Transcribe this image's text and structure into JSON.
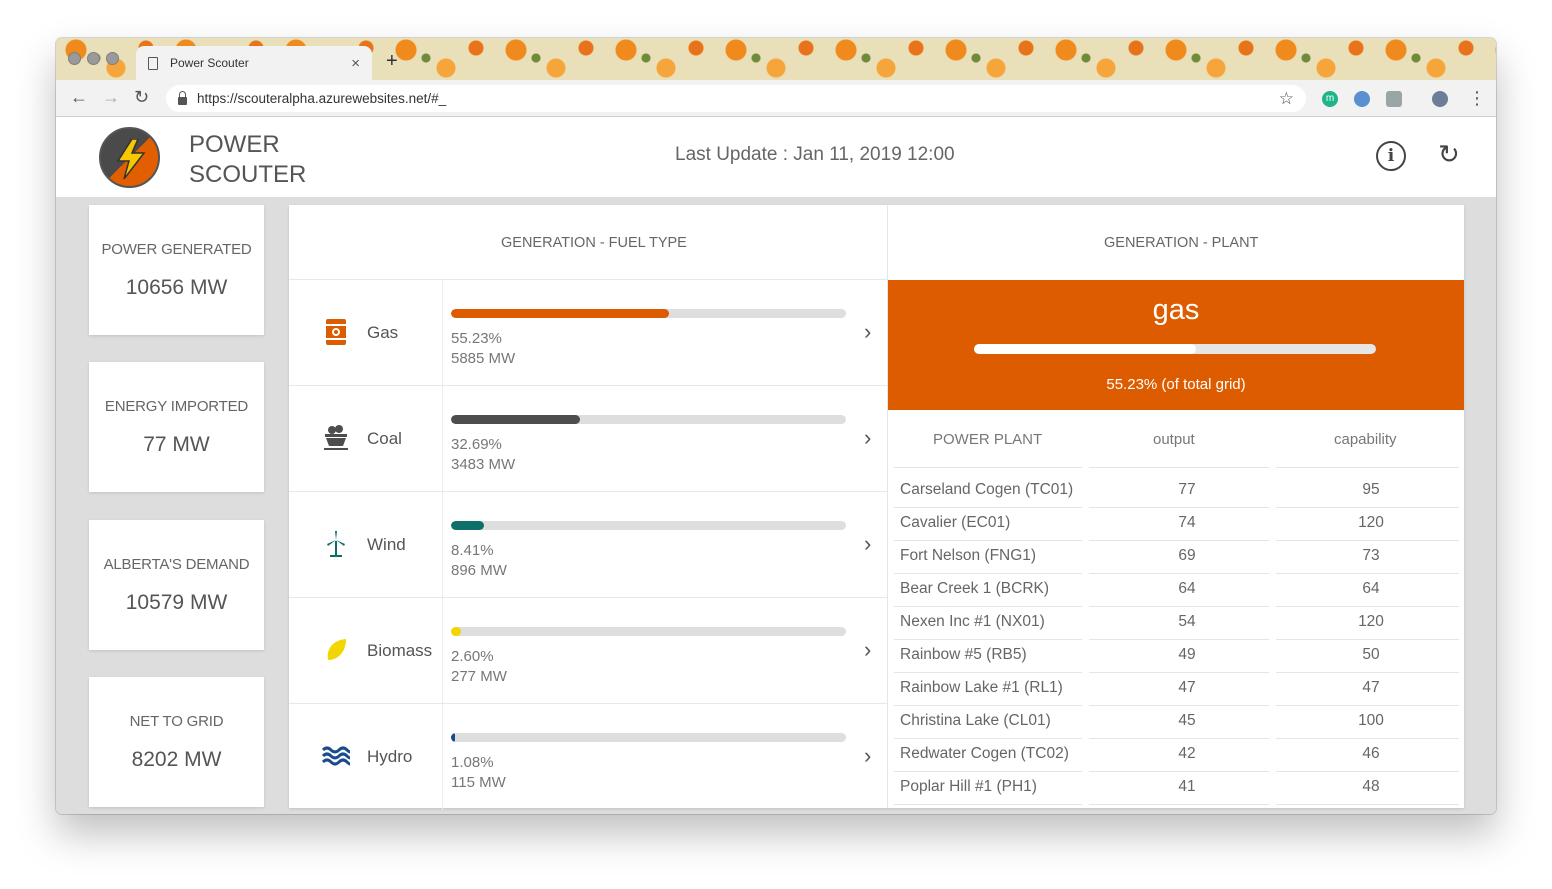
{
  "browser": {
    "tab_title": "Power Scouter",
    "tab_close": "×",
    "new_tab": "+",
    "url": "https://scouteralpha.azurewebsites.net/#_",
    "back": "←",
    "forward": "→",
    "reload": "↻",
    "star": "☆",
    "menu": "⋮",
    "extensions": [
      "m",
      "",
      "",
      ""
    ]
  },
  "header": {
    "app_name_line1": "POWER",
    "app_name_line2": "SCOUTER",
    "last_update": "Last Update : Jan 11, 2019 12:00",
    "info_icon": "i",
    "refresh_icon": "↻"
  },
  "stats": [
    {
      "label": "POWER GENERATED",
      "value": "10656 MW"
    },
    {
      "label": "ENERGY IMPORTED",
      "value": "77 MW"
    },
    {
      "label": "ALBERTA'S DEMAND",
      "value": "10579 MW"
    },
    {
      "label": "NET TO GRID",
      "value": "8202 MW"
    }
  ],
  "fuel_section": {
    "title": "GENERATION - FUEL TYPE",
    "fuels": [
      {
        "name": "Gas",
        "pct": "55.23%",
        "mw": "5885 MW",
        "fraction": 0.5523,
        "color": "#de5c00",
        "icon": "gas-barrel-icon"
      },
      {
        "name": "Coal",
        "pct": "32.69%",
        "mw": "3483 MW",
        "fraction": 0.3269,
        "color": "#4d4d4d",
        "icon": "coal-cart-icon"
      },
      {
        "name": "Wind",
        "pct": "8.41%",
        "mw": "896 MW",
        "fraction": 0.0841,
        "color": "#0e6f6a",
        "icon": "wind-turbine-icon"
      },
      {
        "name": "Biomass",
        "pct": "2.60%",
        "mw": "277 MW",
        "fraction": 0.026,
        "color": "#f2d600",
        "icon": "leaf-icon"
      },
      {
        "name": "Hydro",
        "pct": "1.08%",
        "mw": "115 MW",
        "fraction": 0.0108,
        "color": "#1a4b8c",
        "icon": "waves-icon"
      }
    ],
    "chevron": "›"
  },
  "plant_section": {
    "title": "GENERATION - PLANT",
    "selected_fuel": "gas",
    "selected_fraction": 0.5523,
    "selected_sub": "55.23% (of total grid)",
    "accent": "#de5c00",
    "columns": [
      "POWER PLANT",
      "output",
      "capability"
    ],
    "rows": [
      {
        "name": "Carseland Cogen (TC01)",
        "output": "77",
        "capability": "95"
      },
      {
        "name": "Cavalier (EC01)",
        "output": "74",
        "capability": "120"
      },
      {
        "name": "Fort Nelson (FNG1)",
        "output": "69",
        "capability": "73"
      },
      {
        "name": "Bear Creek 1 (BCRK)",
        "output": "64",
        "capability": "64"
      },
      {
        "name": "Nexen Inc #1 (NX01)",
        "output": "54",
        "capability": "120"
      },
      {
        "name": "Rainbow #5 (RB5)",
        "output": "49",
        "capability": "50"
      },
      {
        "name": "Rainbow Lake #1 (RL1)",
        "output": "47",
        "capability": "47"
      },
      {
        "name": "Christina Lake (CL01)",
        "output": "45",
        "capability": "100"
      },
      {
        "name": "Redwater Cogen (TC02)",
        "output": "42",
        "capability": "46"
      },
      {
        "name": "Poplar Hill #1 (PH1)",
        "output": "41",
        "capability": "48"
      }
    ]
  }
}
